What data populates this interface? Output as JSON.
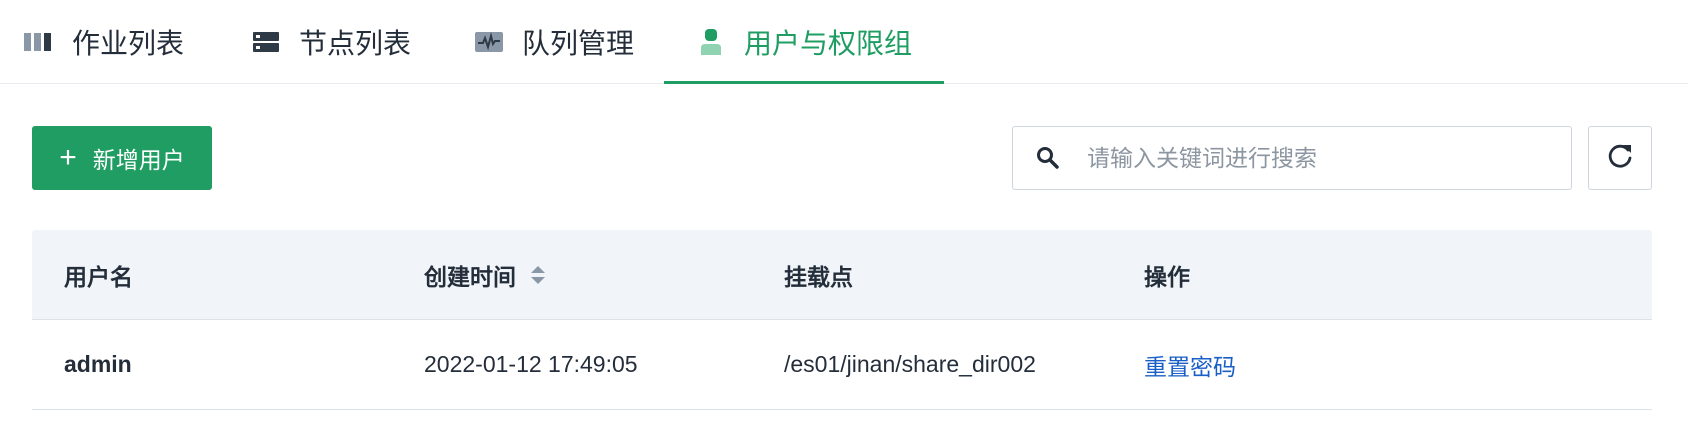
{
  "tabs": [
    {
      "label": "作业列表",
      "icon": "columns-icon",
      "active": false
    },
    {
      "label": "节点列表",
      "icon": "server-icon",
      "active": false
    },
    {
      "label": "队列管理",
      "icon": "pulse-monitor-icon",
      "active": false
    },
    {
      "label": "用户与权限组",
      "icon": "user-icon",
      "active": true
    }
  ],
  "toolbar": {
    "add_label": "新增用户",
    "search_placeholder": "请输入关键词进行搜索",
    "search_value": ""
  },
  "table": {
    "columns": [
      "用户名",
      "创建时间",
      "挂载点",
      "操作"
    ],
    "rows": [
      {
        "username": "admin",
        "created": "2022-01-12 17:49:05",
        "mount": "/es01/jinan/share_dir002",
        "action": "重置密码"
      }
    ]
  },
  "colors": {
    "accent": "#1f9d62",
    "link": "#1a5fc7",
    "header_bg": "#f1f4f8"
  }
}
